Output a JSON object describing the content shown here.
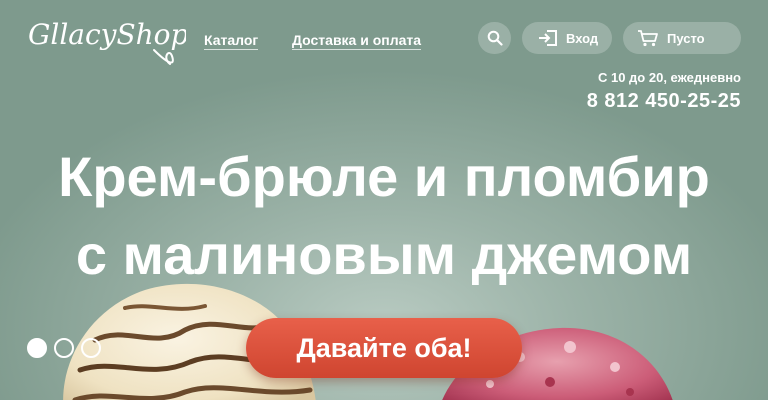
{
  "header": {
    "logo_text": "GllacyShop",
    "nav": [
      {
        "label": "Каталог"
      },
      {
        "label": "Доставка и оплата"
      }
    ],
    "search_icon": "search-icon",
    "login": {
      "label": "Вход",
      "icon": "login-icon"
    },
    "cart": {
      "label": "Пусто",
      "icon": "cart-icon"
    },
    "hours": "С 10 до 20, ежедневно",
    "phone": "8 812 450-25-25"
  },
  "hero": {
    "title_line1": "Крем-брюле и пломбир",
    "title_line2": "с малиновым джемом",
    "cta_label": "Давайте оба!",
    "slides": [
      {
        "active": true
      },
      {
        "active": false
      },
      {
        "active": false
      }
    ]
  },
  "colors": {
    "background": "#8fa89c",
    "accent": "#e0533d",
    "text": "#ffffff"
  }
}
